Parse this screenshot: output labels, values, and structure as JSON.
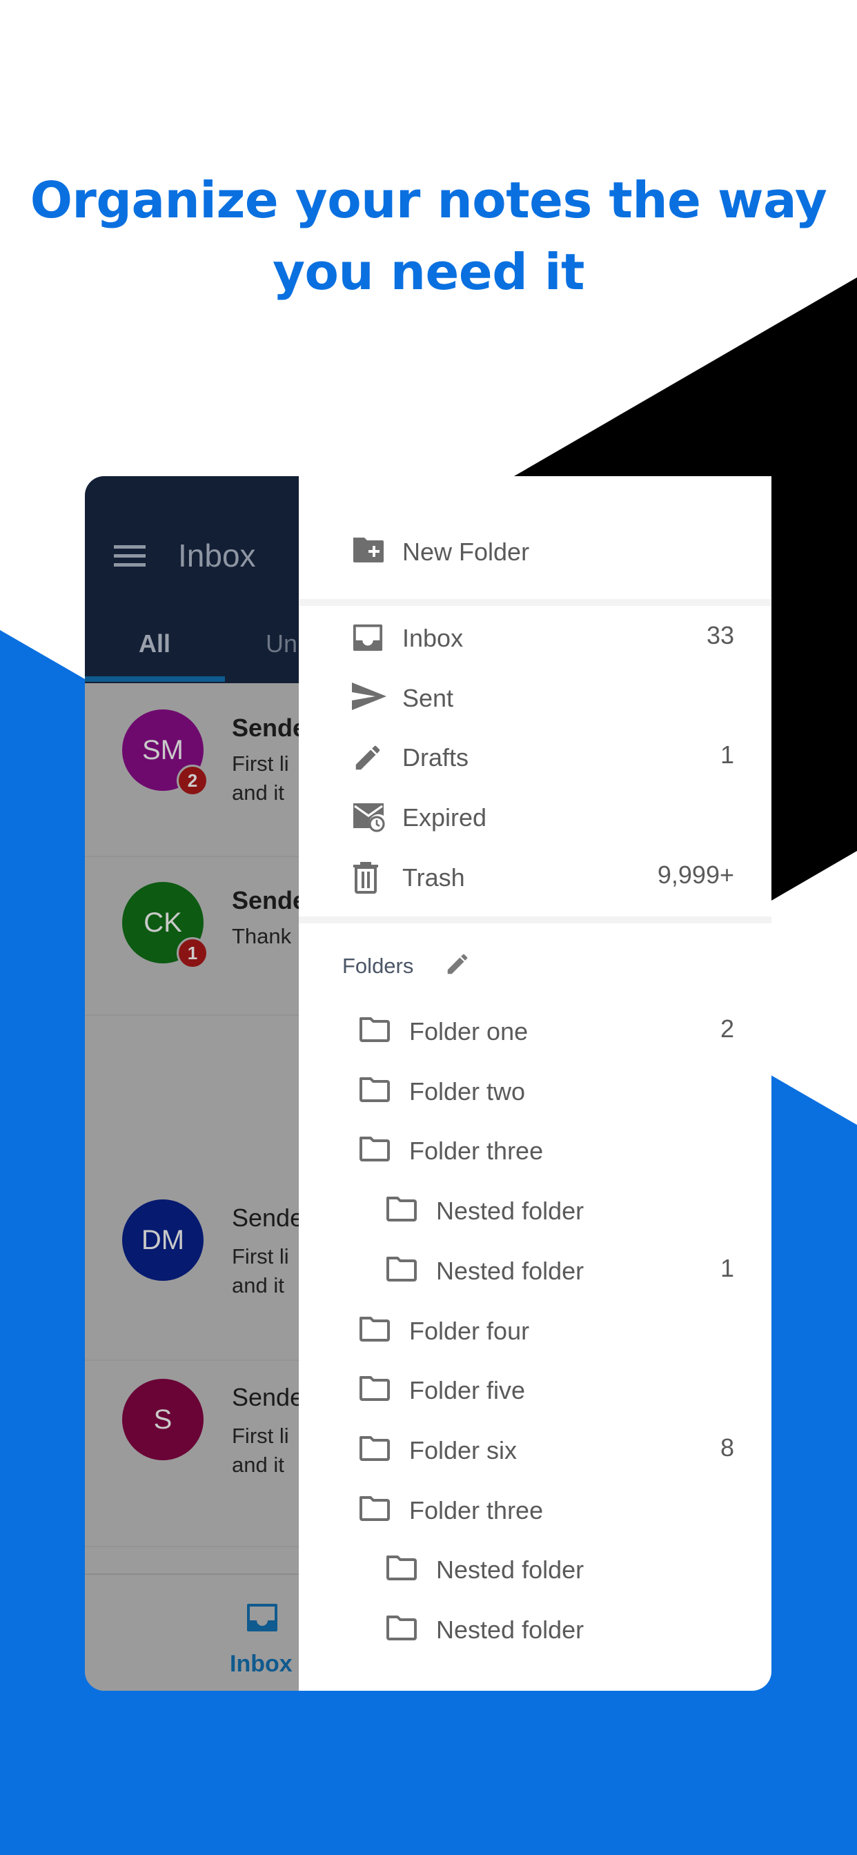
{
  "headline": {
    "line1": "Organize your notes the way",
    "line2": "you need it"
  },
  "colors": {
    "brand_blue": "#0a70e0",
    "black_shape": "#000000",
    "header_dark": "#131f35",
    "accent": "#0f5a8e",
    "icon_gray": "#6e6e6e"
  },
  "inbox_screen": {
    "title": "Inbox",
    "menu_icon": "hamburger-icon",
    "tabs": [
      {
        "label": "All",
        "active": true
      },
      {
        "label": "Un"
      }
    ],
    "messages": [
      {
        "initials": "SM",
        "color": "#6e0a6e",
        "badge": "2",
        "sender": "Sende",
        "preview": "First li\nand it "
      },
      {
        "initials": "CK",
        "color": "#0d5a12",
        "badge": "1",
        "sender": "Sende",
        "preview": "Thank"
      },
      {
        "initials": "DM",
        "color": "#061a70",
        "badge": null,
        "sender": "Sende",
        "preview": "First li\nand it "
      },
      {
        "initials": "S",
        "color": "#6a0336",
        "badge": null,
        "sender": "Sende",
        "preview": "First li\nand it "
      }
    ],
    "bottom_nav": {
      "label": "Inbox",
      "icon": "inbox-icon"
    }
  },
  "drawer": {
    "new_folder": {
      "label": "New Folder",
      "icon": "folder-plus-icon"
    },
    "mailboxes": [
      {
        "label": "Inbox",
        "count": "33",
        "icon": "inbox-icon"
      },
      {
        "label": "Sent",
        "count": "",
        "icon": "send-icon"
      },
      {
        "label": "Drafts",
        "count": "1",
        "icon": "pencil-icon"
      },
      {
        "label": "Expired",
        "count": "",
        "icon": "mail-clock-icon"
      },
      {
        "label": "Trash",
        "count": "9,999+",
        "icon": "trash-icon"
      }
    ],
    "folders_heading": "Folders",
    "folders": [
      {
        "label": "Folder one",
        "count": "2",
        "nested": false
      },
      {
        "label": "Folder two",
        "count": "",
        "nested": false
      },
      {
        "label": "Folder three",
        "count": "",
        "nested": false
      },
      {
        "label": "Nested folder",
        "count": "",
        "nested": true
      },
      {
        "label": "Nested folder",
        "count": "1",
        "nested": true
      },
      {
        "label": "Folder four",
        "count": "",
        "nested": false
      },
      {
        "label": "Folder five",
        "count": "",
        "nested": false
      },
      {
        "label": "Folder six",
        "count": "8",
        "nested": false
      },
      {
        "label": "Folder three",
        "count": "",
        "nested": false
      },
      {
        "label": "Nested folder",
        "count": "",
        "nested": true
      },
      {
        "label": "Nested folder",
        "count": "",
        "nested": true
      }
    ]
  }
}
